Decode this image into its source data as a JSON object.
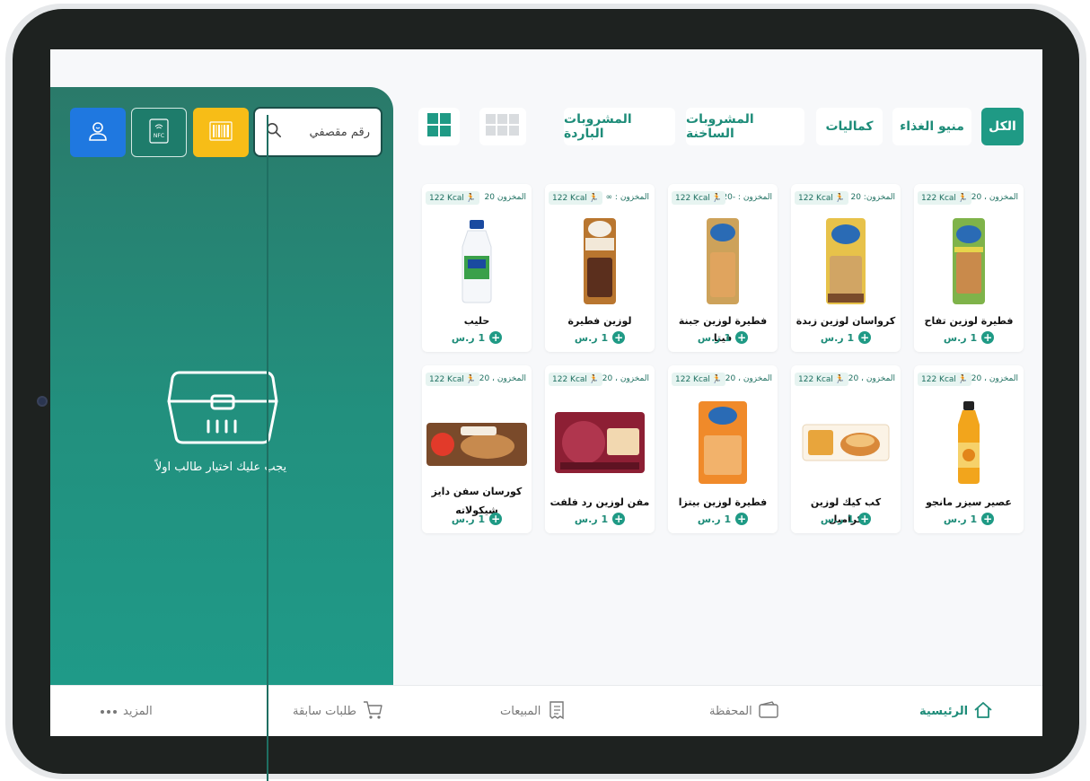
{
  "search": {
    "placeholder": "رقم مقصفي"
  },
  "tools": {
    "nfc_label": "NFC"
  },
  "empty_state": {
    "message": "يجب عليك اختيار طالب اولاً"
  },
  "categories": [
    {
      "label": "الكل",
      "active": true
    },
    {
      "label": "منيو الغذاء",
      "active": false
    },
    {
      "label": "كماليات",
      "active": false
    },
    {
      "label": "المشروبات الساخنة",
      "active": false
    },
    {
      "label": "المشروبات الباردة",
      "active": false
    }
  ],
  "products": [
    {
      "stock": "المخزون ، 20",
      "kcal": "122 Kcal",
      "name": "فطيرة لوزين تفاح",
      "price": "1 ر.س"
    },
    {
      "stock": "المخزون: 20",
      "kcal": "122 Kcal",
      "name": "كرواسان لوزين زبدة",
      "price": "1 ر.س"
    },
    {
      "stock": "المخزون : -20",
      "kcal": "122 Kcal",
      "name": "فطيرة لوزين جبنة فيتا",
      "price": "1 ر.س"
    },
    {
      "stock": "المخزون : ∞",
      "kcal": "122 Kcal",
      "name": "لوزين فطيرة",
      "price": "1 ر.س"
    },
    {
      "stock": "المخزون 20",
      "kcal": "122 Kcal",
      "name": "حليب",
      "price": "1 ر.س"
    },
    {
      "stock": "المخزون ، 20",
      "kcal": "122 Kcal",
      "name": "عصير سيزر مانجو",
      "price": "1 ر.س"
    },
    {
      "stock": "المخزون ، 20",
      "kcal": "122 Kcal",
      "name": "كب كيك لوزين كراميل",
      "price": "1 ر.س"
    },
    {
      "stock": "المخزون ، 20",
      "kcal": "122 Kcal",
      "name": "فطيرة لوزين بيتزا",
      "price": "1 ر.س"
    },
    {
      "stock": "المخزون ، 20",
      "kcal": "122 Kcal",
      "name": "مفن لوزين رد فلفت",
      "price": "1 ر.س"
    },
    {
      "stock": "المخزون ، 20",
      "kcal": "122 Kcal",
      "name": "كورسان سفن دايز شيكولاته",
      "price": "1 ر.س"
    }
  ],
  "bottom_nav": [
    {
      "label": "الرئيسية",
      "icon": "home-icon",
      "active": true
    },
    {
      "label": "المحفظة",
      "icon": "wallet-icon",
      "active": false
    },
    {
      "label": "المبيعات",
      "icon": "receipt-icon",
      "active": false
    },
    {
      "label": "طلبات سابقة",
      "icon": "cart-icon",
      "active": false
    },
    {
      "label": "المزيد",
      "icon": "more-icon",
      "active": false
    }
  ],
  "colors": {
    "primary": "#1f9a85",
    "panel": "#22907e",
    "barcode": "#f7bd17",
    "user": "#1f78e0"
  }
}
